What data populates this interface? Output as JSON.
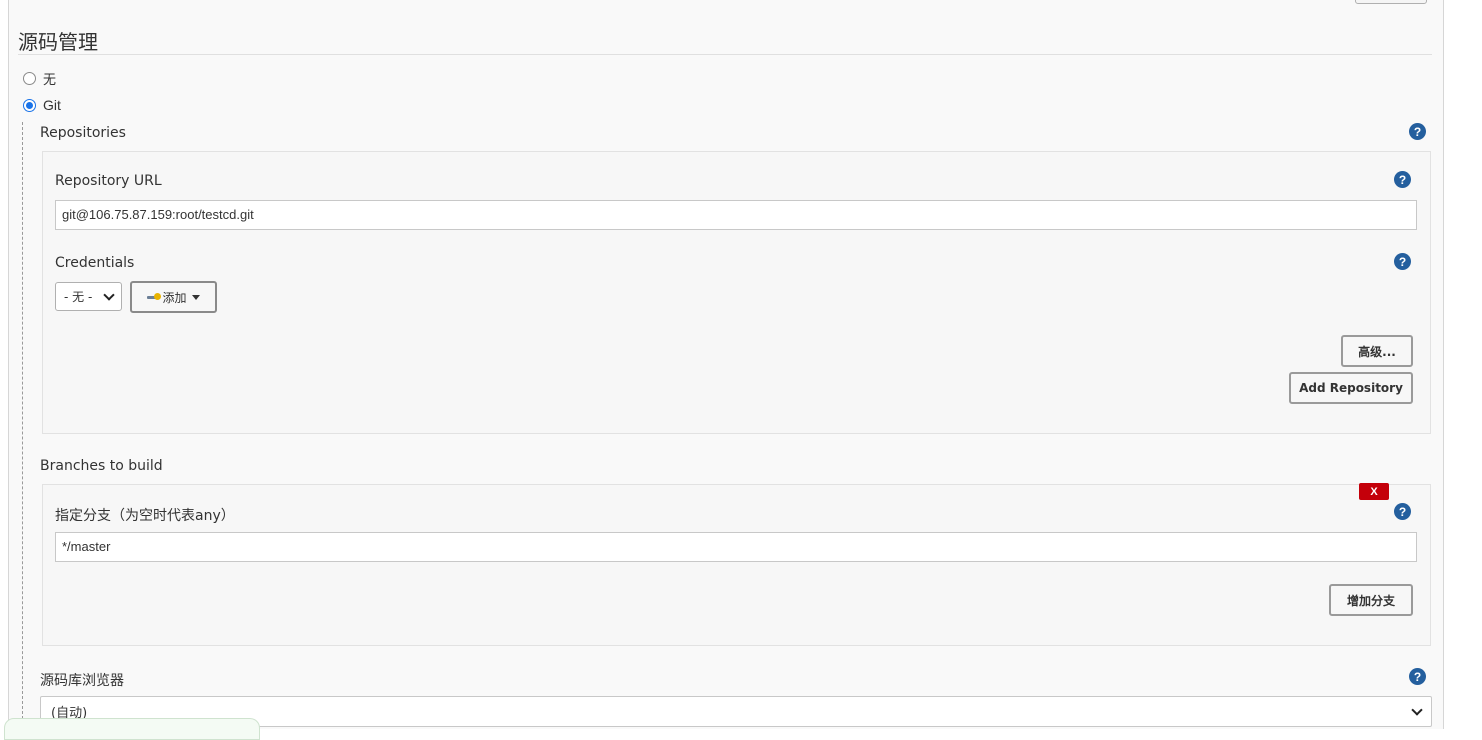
{
  "section": {
    "title": "源码管理"
  },
  "scm_options": [
    {
      "label": "无",
      "checked": false
    },
    {
      "label": "Git",
      "checked": true
    }
  ],
  "repositories": {
    "label": "Repositories",
    "url_label": "Repository URL",
    "url_value": "git@106.75.87.159:root/testcd.git",
    "credentials_label": "Credentials",
    "credentials_selected": "- 无 -",
    "add_label": "添加",
    "advanced_label": "高级...",
    "add_repository_label": "Add Repository"
  },
  "branches": {
    "label": "Branches to build",
    "delete_label": "X",
    "branch_label": "指定分支（为空时代表any）",
    "branch_value": "*/master",
    "add_branch_label": "增加分支"
  },
  "browser": {
    "label": "源码库浏览器",
    "selected": "(自动)"
  },
  "help_glyph": "?",
  "colors": {
    "help": "#245f9e",
    "delete": "#c4000a",
    "radio_checked": "#1a73e8"
  }
}
